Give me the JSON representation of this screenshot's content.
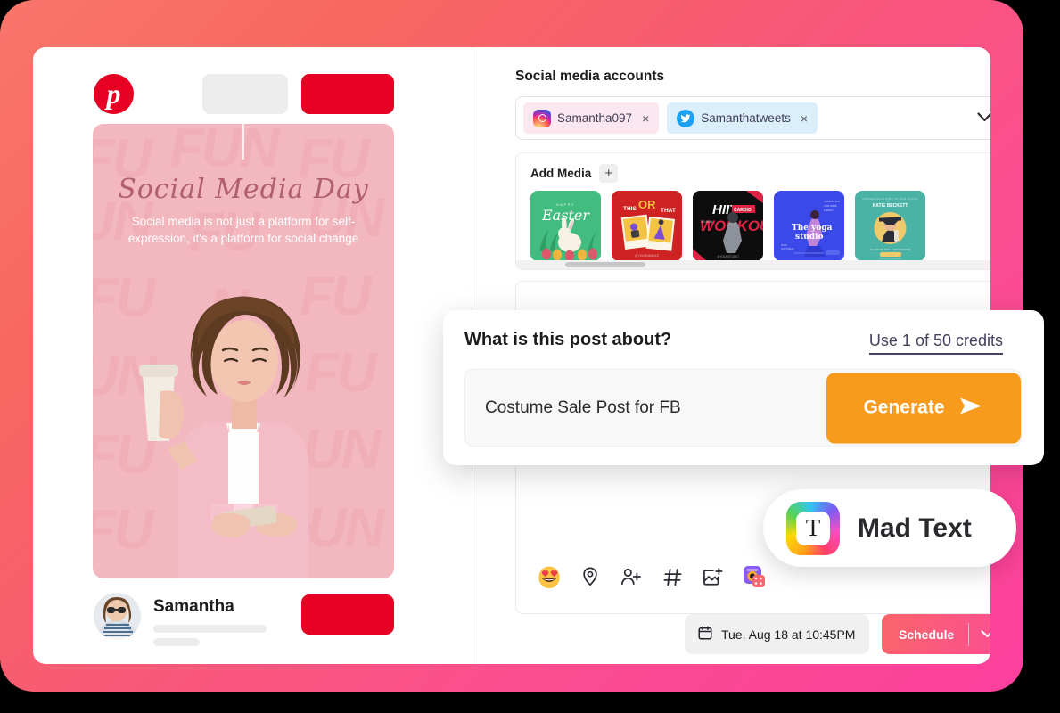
{
  "preview": {
    "platform_icon": "pinterest-logo",
    "post_image": {
      "title": "Social Media Day",
      "subtitle": "Social media is not just a platform for self-expression, it's a platform for social change",
      "watermark_text": "FUN",
      "bg_color": "#f2b7bf"
    },
    "profile": {
      "name": "Samantha"
    },
    "red_button_color": "#e60023"
  },
  "editor": {
    "section_title": "Social media accounts",
    "accounts": [
      {
        "name": "Samantha097",
        "network": "instagram",
        "close": "×"
      },
      {
        "name": "Samanthatweets",
        "network": "twitter",
        "close": "×"
      }
    ],
    "accounts_caret": "chevron-down-icon",
    "media": {
      "label": "Add Media",
      "add_symbol": "+",
      "thumbnails": [
        {
          "title": "Easter",
          "kicker": "HAPPY",
          "color": "#43bd7f"
        },
        {
          "title": "THIS OR THAT",
          "kicker": "",
          "color": "#cf2222"
        },
        {
          "title": "HIIT WORKOUT",
          "kicker": "",
          "color": "#0d0d0d"
        },
        {
          "title": "The yoga studio",
          "kicker": "",
          "color": "#3b49e8"
        },
        {
          "title": "KATIE BECKETT",
          "kicker": "",
          "color": "#4ab3a5"
        }
      ]
    },
    "toolbar_icons": [
      "smiling-face-with-hearts-emoji",
      "location-pin-icon",
      "add-person-icon",
      "hashtag-icon",
      "add-image-icon",
      "app-shortcut-icon"
    ],
    "schedule": {
      "date_text": "Tue, Aug 18 at 10:45PM",
      "calendar_icon": "calendar-icon",
      "button_label": "Schedule",
      "button_caret": "chevron-down-icon"
    }
  },
  "ai_modal": {
    "question": "What is this post about?",
    "credits_link": "Use 1 of 50 credits",
    "input_value": "Costume Sale Post for FB",
    "input_placeholder": "What is this post about?",
    "generate_label": "Generate",
    "generate_icon": "send-arrow-icon",
    "generate_color": "#f89b1c"
  },
  "mad_text_badge": {
    "label": "Mad Text",
    "icon": "mad-text-logo",
    "icon_letter": "T"
  }
}
